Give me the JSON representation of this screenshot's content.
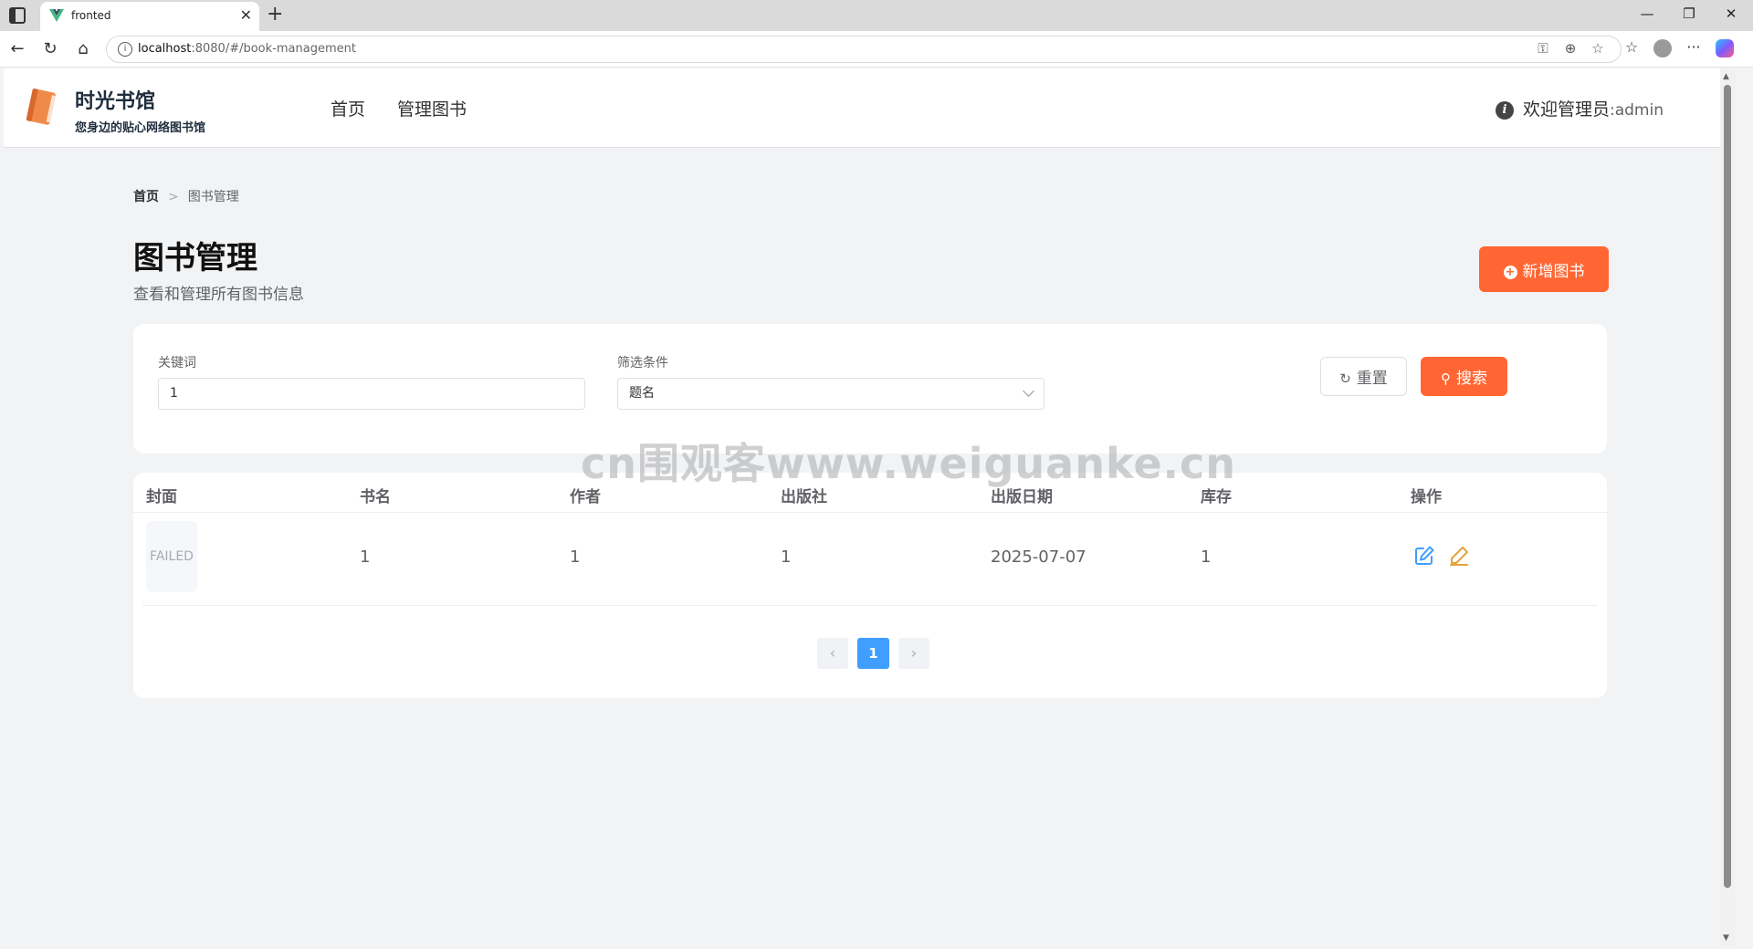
{
  "browser": {
    "tab_title": "fronted",
    "url_host": "localhost",
    "url_rest": ":8080/#/book-management"
  },
  "header": {
    "brand_title": "时光书馆",
    "brand_subtitle": "您身边的贴心网络图书馆",
    "nav": [
      "首页",
      "管理图书"
    ],
    "welcome_label": "欢迎管理员",
    "welcome_user": ":admin"
  },
  "breadcrumb": {
    "home": "首页",
    "separator": ">",
    "current": "图书管理"
  },
  "page": {
    "title": "图书管理",
    "subtitle": "查看和管理所有图书信息",
    "add_button": "新增图书"
  },
  "search": {
    "keyword_label": "关键词",
    "keyword_value": "1",
    "filter_label": "筛选条件",
    "filter_value": "题名",
    "reset_button": "重置",
    "search_button": "搜索"
  },
  "table": {
    "columns": [
      "封面",
      "书名",
      "作者",
      "出版社",
      "出版日期",
      "库存",
      "操作"
    ],
    "rows": [
      {
        "cover": "FAILED",
        "title": "1",
        "author": "1",
        "publisher": "1",
        "date": "2025-07-07",
        "stock": "1"
      }
    ]
  },
  "pagination": {
    "current_page": "1"
  },
  "watermark": "cn围观客www.weiguanke.cn",
  "colors": {
    "primary": "#ff6633",
    "pager_active": "#409eff",
    "edit_icon": "#409eff",
    "edit_alt_icon": "#e6a23c"
  }
}
